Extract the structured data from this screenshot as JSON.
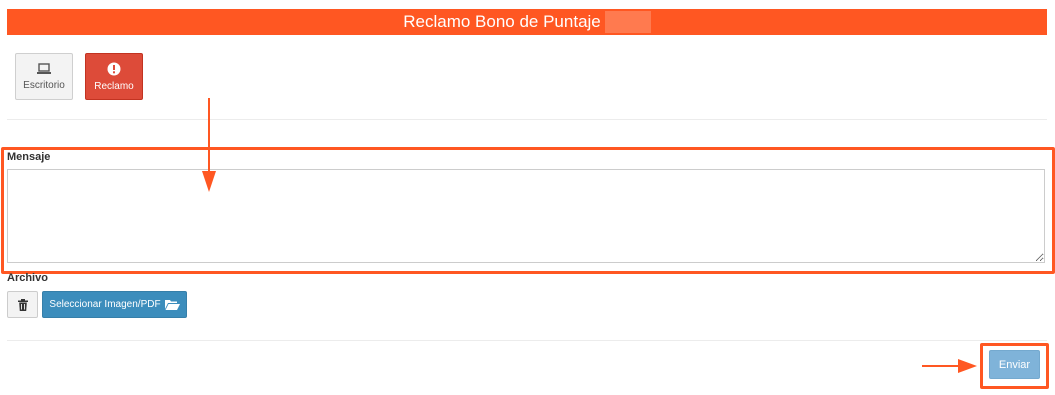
{
  "header": {
    "title": "Reclamo Bono de Puntaje"
  },
  "tiles": [
    {
      "label": "Escritorio",
      "icon": "laptop-icon"
    },
    {
      "label": "Reclamo",
      "icon": "exclamation-circle-icon"
    }
  ],
  "form": {
    "message_label": "Mensaje",
    "message_value": "",
    "file_label": "Archivo",
    "upload_label": "Seleccionar Imagen/PDF",
    "submit_label": "Enviar"
  },
  "colors": {
    "header": "#ff5722",
    "annotation": "#ff5722",
    "danger": "#dd4b39",
    "primary": "#3c8dbc",
    "submit": "#7fb3d9"
  }
}
